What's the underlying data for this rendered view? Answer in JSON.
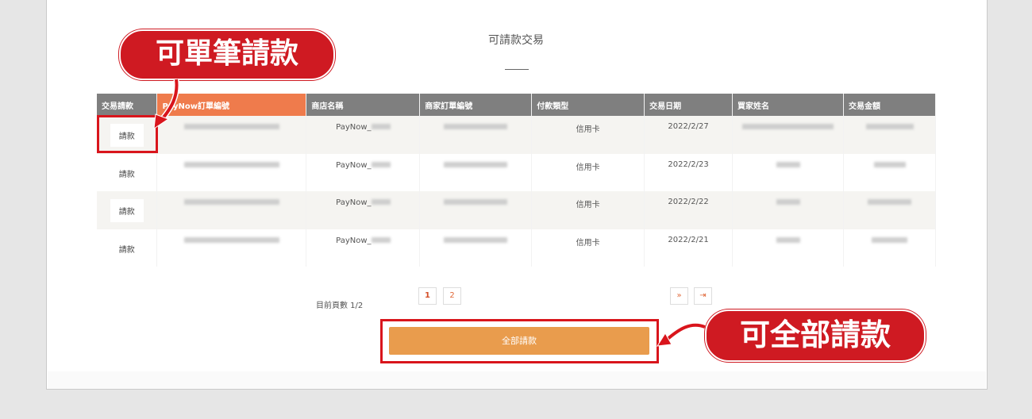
{
  "title": "可請款交易",
  "table": {
    "headers": [
      "交易請款",
      "PayNow訂單編號",
      "商店名稱",
      "商家訂單編號",
      "付款類型",
      "交易日期",
      "買家姓名",
      "交易金額"
    ],
    "rows": [
      {
        "action": "請款",
        "store": "PayNow_",
        "pay_type": "信用卡",
        "date": "2022/2/27"
      },
      {
        "action": "請款",
        "store": "PayNow_",
        "pay_type": "信用卡",
        "date": "2022/2/23"
      },
      {
        "action": "請款",
        "store": "PayNow_",
        "pay_type": "信用卡",
        "date": "2022/2/22"
      },
      {
        "action": "請款",
        "store": "PayNow_",
        "pay_type": "信用卡",
        "date": "2022/2/21"
      }
    ]
  },
  "pagination": {
    "info": "目前頁數 1/2",
    "pages": [
      "1",
      "2"
    ],
    "next": "»",
    "last": "⇥"
  },
  "all_button": "全部請款",
  "callouts": {
    "single": "可單筆請款",
    "all": "可全部請款"
  },
  "colors": {
    "header_bg": "#7f7f7f",
    "header_highlight": "#ef7b4c",
    "button_orange": "#e99c4d",
    "callout_red": "#cf1a22"
  }
}
